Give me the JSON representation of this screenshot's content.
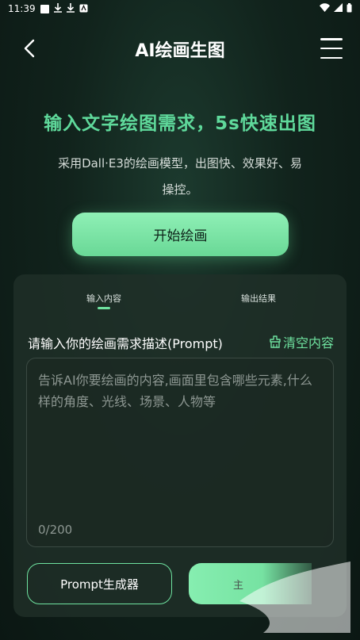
{
  "status_bar": {
    "time": "11:39"
  },
  "header": {
    "title": "AI绘画生图"
  },
  "hero": {
    "title": "输入文字绘图需求，5s快速出图",
    "description": "采用Dall·E3的绘画模型，出图快、效果好、易操控。",
    "start_button_label": "开始绘画"
  },
  "card": {
    "tabs": [
      {
        "label": "输入内容",
        "active": true
      },
      {
        "label": "输出结果",
        "active": false
      }
    ],
    "prompt_label": "请输入你的绘画需求描述(Prompt)",
    "clear_label": "清空内容",
    "prompt_value": "",
    "prompt_placeholder": "告诉AI你要绘画的内容,画面里包含哪些元素,什么样的角度、光线、场景、人物等",
    "char_count": "0/200",
    "generator_label": "Prompt生成器",
    "submit_label": "主"
  },
  "colors": {
    "accent": "#6fe3a0",
    "hero_title": "#5fd99b",
    "background": "#11231c",
    "card": "#20302a"
  },
  "icons": [
    "back-arrow-icon",
    "menu-icon",
    "clear-icon",
    "wifi-icon",
    "signal-icon",
    "battery-icon",
    "download-icon"
  ]
}
